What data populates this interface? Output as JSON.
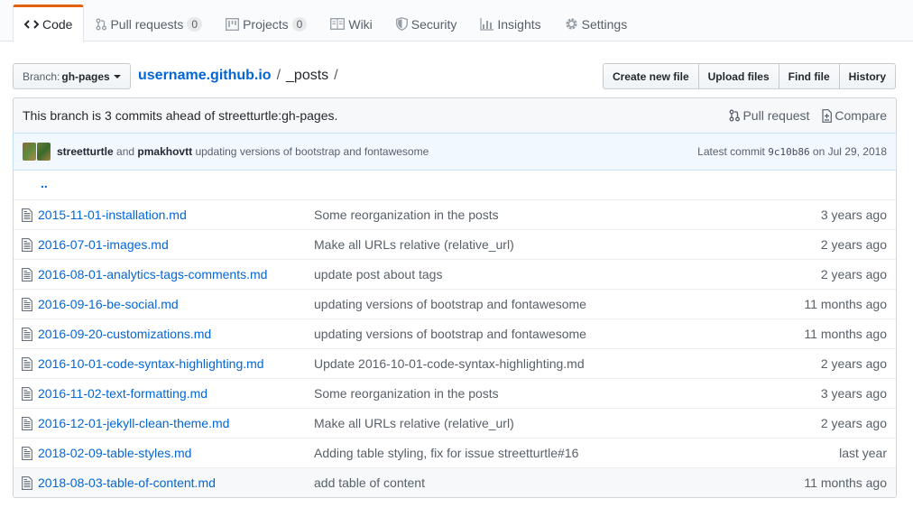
{
  "nav": {
    "tabs": [
      {
        "label": "Code",
        "icon": "code-icon",
        "counter": null,
        "selected": true
      },
      {
        "label": "Pull requests",
        "icon": "pull-request-icon",
        "counter": "0",
        "selected": false
      },
      {
        "label": "Projects",
        "icon": "project-icon",
        "counter": "0",
        "selected": false
      },
      {
        "label": "Wiki",
        "icon": "book-icon",
        "counter": null,
        "selected": false
      },
      {
        "label": "Security",
        "icon": "shield-icon",
        "counter": null,
        "selected": false
      },
      {
        "label": "Insights",
        "icon": "graph-icon",
        "counter": null,
        "selected": false
      },
      {
        "label": "Settings",
        "icon": "gear-icon",
        "counter": null,
        "selected": false
      }
    ]
  },
  "branch": {
    "prefix": "Branch:",
    "name": "gh-pages"
  },
  "breadcrumb": {
    "root": "username.github.io",
    "separator": "/",
    "path": "_posts",
    "trailing": "/"
  },
  "actions": {
    "create": "Create new file",
    "upload": "Upload files",
    "find": "Find file",
    "history": "History"
  },
  "infobar": {
    "text": "This branch is 3 commits ahead of streetturtle:gh-pages.",
    "pull_request": "Pull request",
    "compare": "Compare"
  },
  "commit": {
    "author1": "streetturtle",
    "and": "and",
    "author2": "pmakhovtt",
    "message": "updating versions of bootstrap and fontawesome",
    "latest_label": "Latest commit",
    "sha": "9c10b86",
    "on": "on",
    "date": "Jul 29, 2018"
  },
  "up_tree": "..",
  "files": [
    {
      "name": "2015-11-01-installation.md",
      "message": "Some reorganization in the posts",
      "age": "3 years ago"
    },
    {
      "name": "2016-07-01-images.md",
      "message": "Make all URLs relative (relative_url)",
      "age": "2 years ago"
    },
    {
      "name": "2016-08-01-analytics-tags-comments.md",
      "message": "update post about tags",
      "age": "2 years ago"
    },
    {
      "name": "2016-09-16-be-social.md",
      "message": "updating versions of bootstrap and fontawesome",
      "age": "11 months ago"
    },
    {
      "name": "2016-09-20-customizations.md",
      "message": "updating versions of bootstrap and fontawesome",
      "age": "11 months ago"
    },
    {
      "name": "2016-10-01-code-syntax-highlighting.md",
      "message": "Update 2016-10-01-code-syntax-highlighting.md",
      "age": "2 years ago"
    },
    {
      "name": "2016-11-02-text-formatting.md",
      "message": "Some reorganization in the posts",
      "age": "3 years ago"
    },
    {
      "name": "2016-12-01-jekyll-clean-theme.md",
      "message": "Make all URLs relative (relative_url)",
      "age": "2 years ago"
    },
    {
      "name": "2018-02-09-table-styles.md",
      "message": "Adding table styling, fix for issue streetturtle#16",
      "age": "last year"
    },
    {
      "name": "2018-08-03-table-of-content.md",
      "message": "add table of content",
      "age": "11 months ago"
    }
  ],
  "colors": {
    "link": "#0366d6",
    "selected_tab_accent": "#e36209",
    "muted": "#586069",
    "commit_bg": "#f1f8ff"
  }
}
